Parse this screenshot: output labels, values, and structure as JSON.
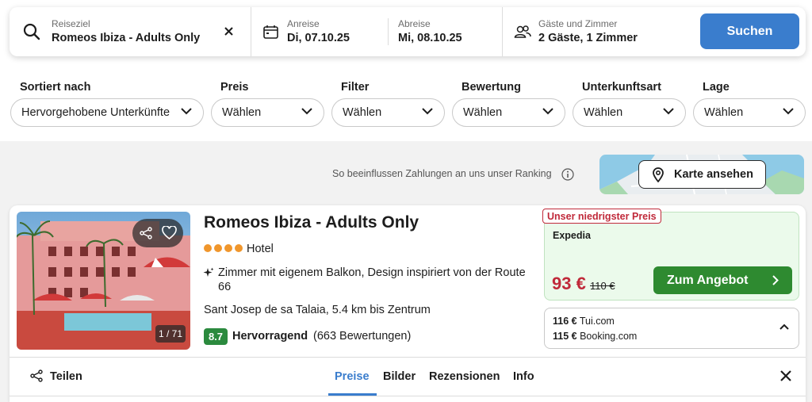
{
  "search": {
    "destination_label": "Reiseziel",
    "destination_value": "Romeos Ibiza - Adults Only",
    "checkin_label": "Anreise",
    "checkin_value": "Di, 07.10.25",
    "checkout_label": "Abreise",
    "checkout_value": "Mi, 08.10.25",
    "guests_label": "Gäste und Zimmer",
    "guests_value": "2 Gäste, 1 Zimmer",
    "search_button": "Suchen"
  },
  "filters": [
    {
      "label": "Sortiert nach",
      "value": "Hervorgehobene Unterkünfte"
    },
    {
      "label": "Preis",
      "value": "Wählen"
    },
    {
      "label": "Filter",
      "value": "Wählen"
    },
    {
      "label": "Bewertung",
      "value": "Wählen"
    },
    {
      "label": "Unterkunftsart",
      "value": "Wählen"
    },
    {
      "label": "Lage",
      "value": "Wählen"
    }
  ],
  "ranking_note": "So beeinflussen Zahlungen an uns unser Ranking",
  "map_button": "Karte ansehen",
  "hotel": {
    "name": "Romeos Ibiza - Adults Only",
    "stars": 4,
    "type": "Hotel",
    "feature": "Zimmer mit eigenem Balkon, Design inspiriert von der Route 66",
    "location": "Sant Josep de sa Talaia, 5.4 km bis Zentrum",
    "score": "8.7",
    "rating_word": "Hervorragend",
    "rating_count": "(663 Bewertungen)",
    "photo_counter": "1 / 71"
  },
  "deal": {
    "badge": "Unser niedrigster Preis",
    "provider": "Expedia",
    "price": "93 €",
    "old_price": "110 €",
    "button": "Zum Angebot"
  },
  "other_offers": [
    {
      "price": "116 €",
      "provider": "Tui.com"
    },
    {
      "price": "115 €",
      "provider": "Booking.com"
    }
  ],
  "tabs": {
    "share": "Teilen",
    "items": [
      "Preise",
      "Bilder",
      "Rezensionen",
      "Info"
    ],
    "active": "Preise"
  },
  "colors": {
    "primary": "#3a7dcd",
    "deal_green": "#2e8a30",
    "price_red": "#c0293a",
    "star_orange": "#f0962c",
    "score_green": "#2b8a3e"
  }
}
